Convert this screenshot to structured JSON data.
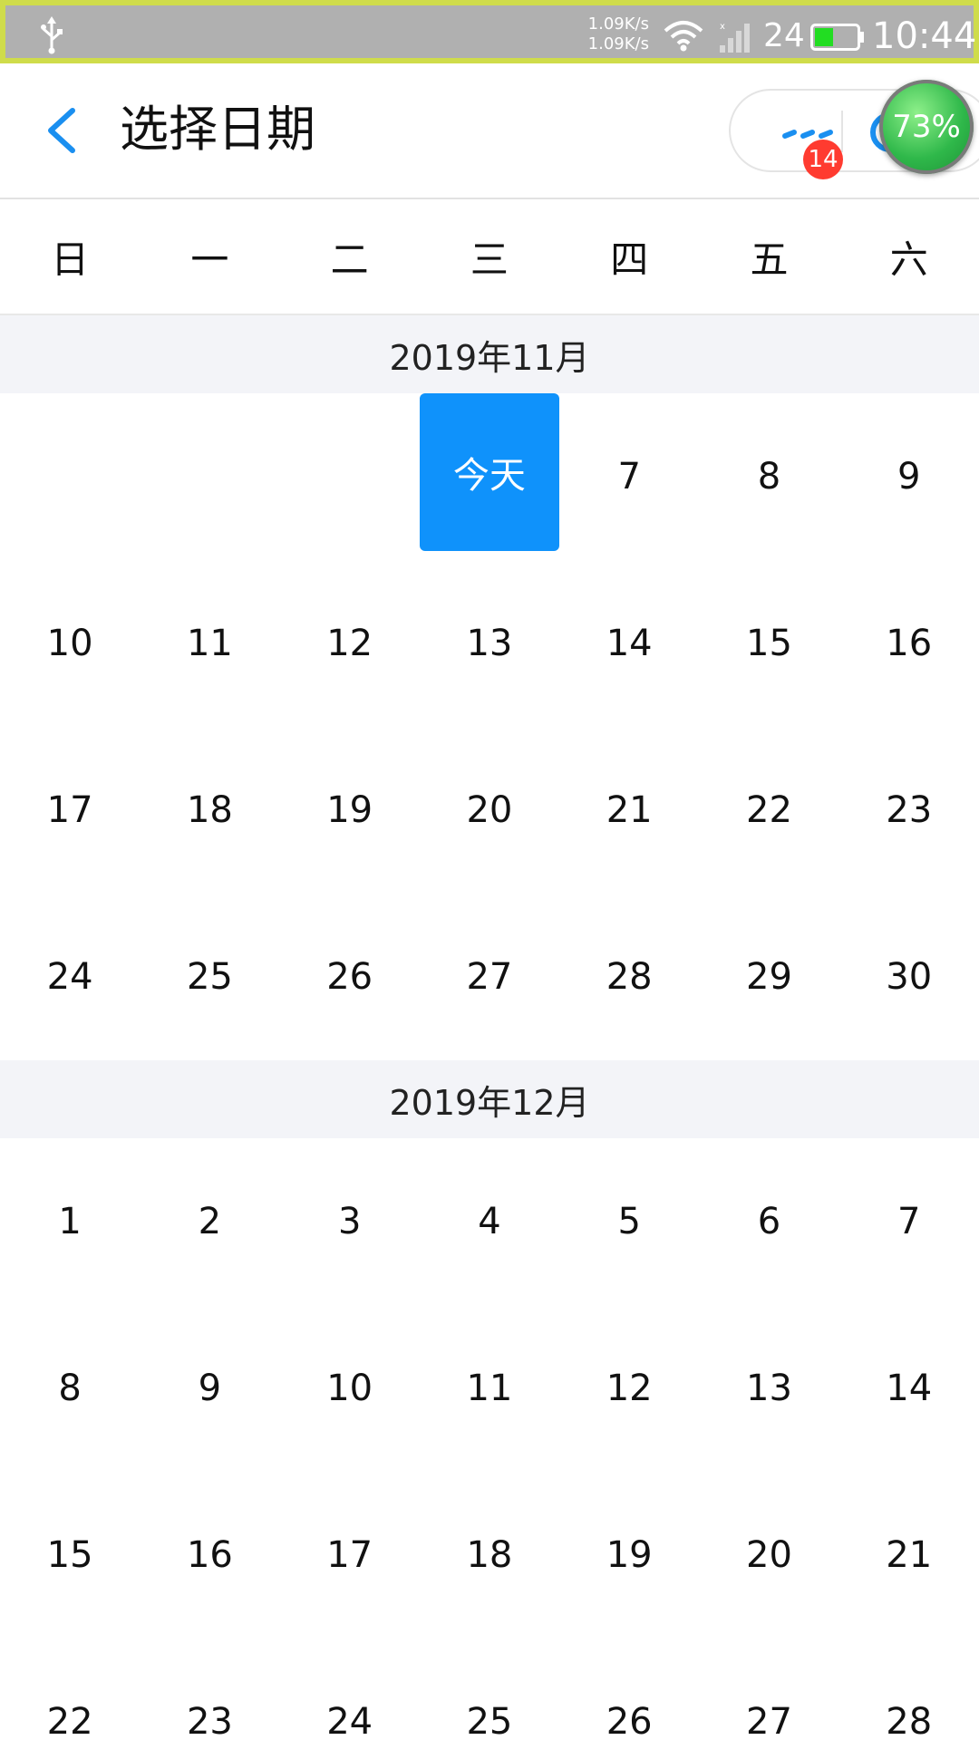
{
  "status_bar": {
    "net_up": "1.09K/s",
    "net_down": "1.09K/s",
    "battery_level": "24",
    "time": "10:44",
    "icons": [
      "usb-icon",
      "wifi-icon",
      "signal-icon",
      "battery-icon"
    ],
    "colors": {
      "background": "#b0b0b0",
      "border": "#cfdc4b",
      "battery_fill": "#22dd22"
    }
  },
  "header": {
    "title": "选择日期",
    "back_icon": "chevron-left-icon",
    "more_icon": "more-dots-icon",
    "close_icon": "close-ring-icon",
    "badge_count": "14",
    "float_ball_value": "73%",
    "colors": {
      "accent": "#1a8ff0",
      "badge": "#ff3b30"
    }
  },
  "weekdays": [
    "日",
    "一",
    "二",
    "三",
    "四",
    "五",
    "六"
  ],
  "today_label": "今天",
  "months": [
    {
      "title": "2019年11月",
      "days": [
        "",
        "",
        "",
        "今天",
        "7",
        "8",
        "9",
        "10",
        "11",
        "12",
        "13",
        "14",
        "15",
        "16",
        "17",
        "18",
        "19",
        "20",
        "21",
        "22",
        "23",
        "24",
        "25",
        "26",
        "27",
        "28",
        "29",
        "30"
      ]
    },
    {
      "title": "2019年12月",
      "days": [
        "1",
        "2",
        "3",
        "4",
        "5",
        "6",
        "7",
        "8",
        "9",
        "10",
        "11",
        "12",
        "13",
        "14",
        "15",
        "16",
        "17",
        "18",
        "19",
        "20",
        "21",
        "22",
        "23",
        "24",
        "25",
        "26",
        "27",
        "28"
      ]
    }
  ],
  "colors": {
    "today_background": "#0f92fb",
    "month_header_background": "#f3f4f8"
  }
}
